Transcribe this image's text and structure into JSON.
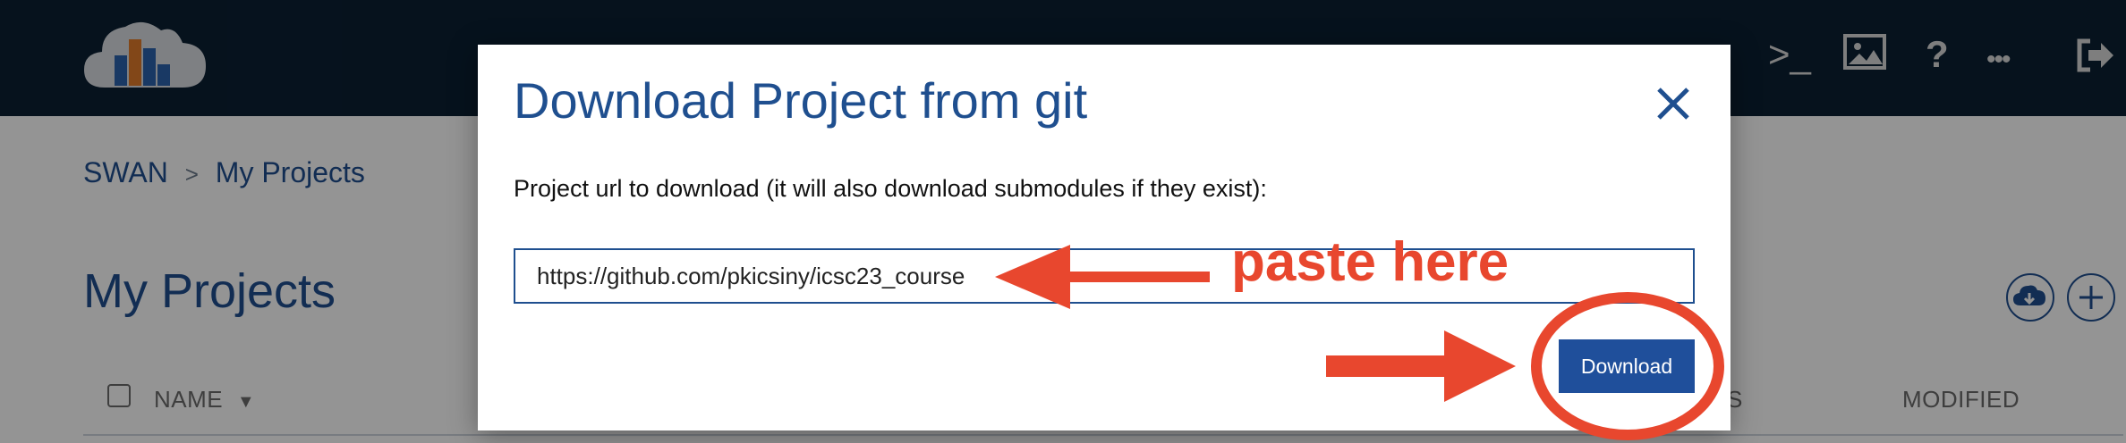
{
  "nav": {
    "icons": [
      "cloud-logo",
      "terminal-icon",
      "image-icon",
      "help-icon",
      "more-icon",
      "logout-icon"
    ],
    "terminal_glyph": ">_",
    "help_glyph": "?",
    "more_glyph": "•••"
  },
  "breadcrumb": {
    "root": "SWAN",
    "sep": ">",
    "current": "My Projects"
  },
  "page": {
    "title": "My Projects"
  },
  "table": {
    "headers": {
      "name": "NAME",
      "s": "S",
      "modified": "MODIFIED"
    }
  },
  "modal": {
    "title": "Download Project from git",
    "label": "Project url to download (it will also download submodules if they exist):",
    "url_value": "https://github.com/pkicsiny/icsc23_course",
    "download_label": "Download"
  },
  "annotation": {
    "text": "paste here",
    "color": "#e8472e"
  },
  "colors": {
    "topbar": "#0b1f33",
    "brand": "#1f4f8f",
    "button": "#1f4f9b",
    "annotation": "#e8472e"
  }
}
